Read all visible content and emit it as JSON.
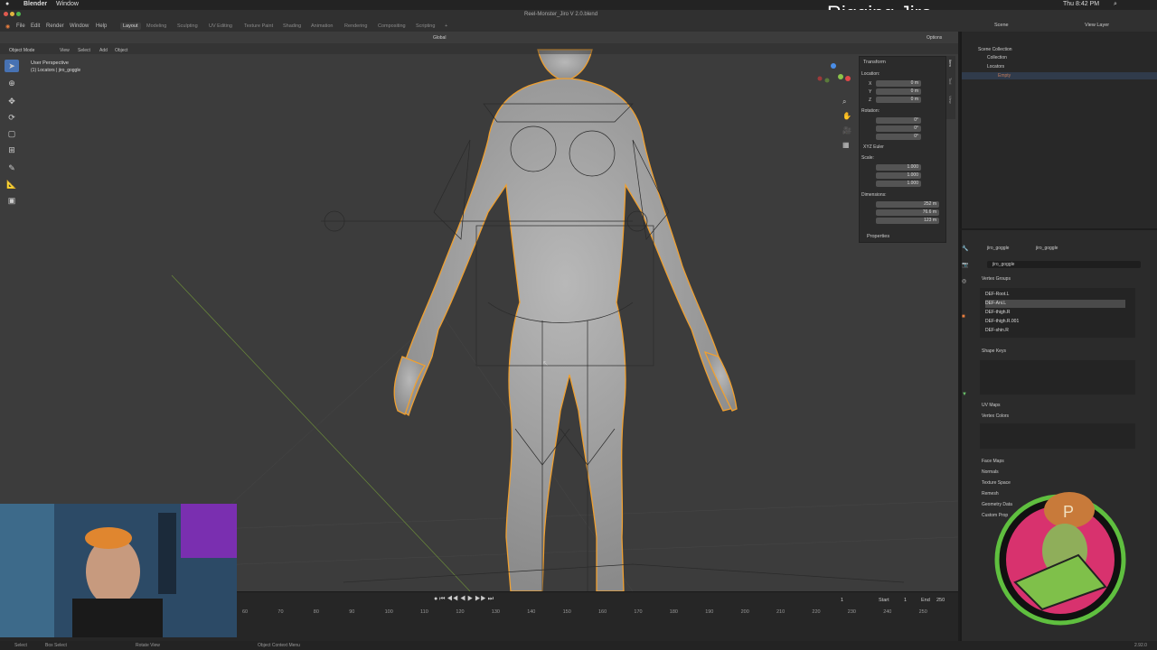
{
  "overlay_title": "Rigging Jiro",
  "macbar": {
    "app": "Blender",
    "menu": "Window",
    "file_title": "Reel-Monster_Jiro V 2.0.blend",
    "clock": "Thu 8:42 PM"
  },
  "blender_menu": [
    "File",
    "Edit",
    "Render",
    "Window",
    "Help"
  ],
  "workspaces": [
    "Layout",
    "Modeling",
    "Sculpting",
    "UV Editing",
    "Texture Paint",
    "Shading",
    "Animation",
    "Rendering",
    "Compositing",
    "Scripting"
  ],
  "active_workspace": "Layout",
  "scene": {
    "name": "Scene",
    "view_layer": "View Layer"
  },
  "viewport": {
    "mode": "Object Mode",
    "menu": [
      "View",
      "Select",
      "Add",
      "Object"
    ],
    "transform_orientation": "Global",
    "options_label": "Options",
    "perspective_label": "User Perspective",
    "collection_label": "(1) Locators | jiro_goggle"
  },
  "npanel": {
    "section": "Transform",
    "tabs": [
      "Item",
      "Tool",
      "View"
    ],
    "location_label": "Location:",
    "location": {
      "x": "0 m",
      "y": "0 m",
      "z": "0 m"
    },
    "rotation_label": "Rotation:",
    "rotation": {
      "x": "0°",
      "y": "0°",
      "z": "0°"
    },
    "rotation_mode": "XYZ Euler",
    "scale_label": "Scale:",
    "scale": {
      "x": "1.000",
      "y": "1.000",
      "z": "1.000"
    },
    "dimensions_label": "Dimensions:",
    "dimensions": {
      "x": "252 m",
      "y": "76.6 m",
      "z": "123 m"
    },
    "properties_label": "Properties"
  },
  "outliner": {
    "root": "Scene Collection",
    "items": [
      "Collection",
      "Locators",
      "Empty"
    ]
  },
  "properties": {
    "object_name": "jiro_goggle",
    "data_name": "jiro_goggle",
    "mesh_name": "jiro_goggle",
    "vertex_groups_label": "Vertex Groups",
    "vertex_groups": [
      "DEF-Root.L",
      "DEF-Ani.L",
      "DEF-thigh.R",
      "DEF-thigh.R.001",
      "DEF-shin.R"
    ],
    "sections": [
      "Shape Keys",
      "UV Maps",
      "Vertex Colors",
      "Face Maps",
      "Normals",
      "Texture Space",
      "Remesh",
      "Geometry Data",
      "Custom Prop"
    ]
  },
  "timeline": {
    "ticks": [
      "60",
      "70",
      "80",
      "90",
      "100",
      "110",
      "120",
      "130",
      "140",
      "150",
      "160",
      "170",
      "180",
      "190",
      "200",
      "210",
      "220",
      "230",
      "240",
      "250"
    ],
    "current_frame": "1",
    "start_label": "Start",
    "start": "1",
    "end_label": "End",
    "end": "250"
  },
  "statusbar": {
    "select": "Select",
    "box_select": "Box Select",
    "rotate_view": "Rotate View",
    "context_menu": "Object Context Menu",
    "version": "2.92.0"
  },
  "colors": {
    "accent": "#4772b3",
    "selected_outline": "#f0a030",
    "active_object": "#e87d3e"
  }
}
